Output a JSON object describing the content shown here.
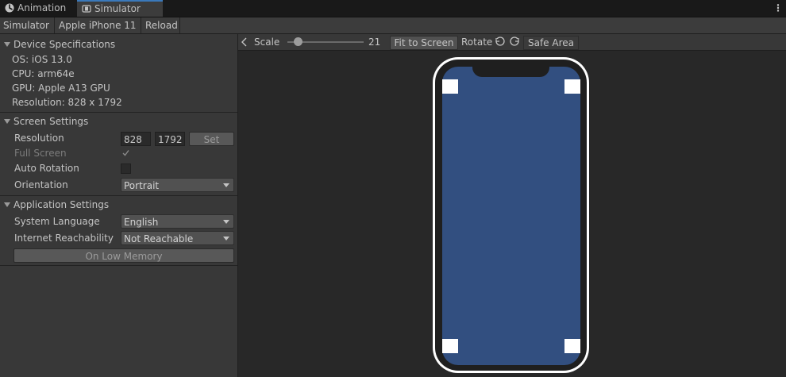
{
  "tabs": {
    "animation": "Animation",
    "simulator": "Simulator"
  },
  "toolbar": {
    "simulator": "Simulator",
    "device": "Apple iPhone 11",
    "reload": "Reload"
  },
  "device_specs": {
    "title": "Device Specifications",
    "os": "OS: iOS 13.0",
    "cpu": "CPU: arm64e",
    "gpu": "GPU: Apple A13 GPU",
    "resolution": "Resolution: 828 x 1792"
  },
  "screen_settings": {
    "title": "Screen Settings",
    "resolution_label": "Resolution",
    "width": "828",
    "height": "1792",
    "set_label": "Set",
    "full_screen_label": "Full Screen",
    "full_screen_checked": true,
    "auto_rotation_label": "Auto Rotation",
    "auto_rotation_checked": false,
    "orientation_label": "Orientation",
    "orientation_value": "Portrait"
  },
  "app_settings": {
    "title": "Application Settings",
    "language_label": "System Language",
    "language_value": "English",
    "reachability_label": "Internet Reachability",
    "reachability_value": "Not Reachable",
    "low_memory_label": "On Low Memory"
  },
  "viewport": {
    "scale_label": "Scale",
    "scale_value": "21",
    "fit_label": "Fit to Screen",
    "rotate_label": "Rotate",
    "safe_area_label": "Safe Area"
  },
  "colors": {
    "screen": "#324f80",
    "accent": "#3a79bb"
  },
  "icons": [
    "unity-icon",
    "simulator-icon",
    "kebab-menu-icon",
    "chevron-left-icon",
    "rotate-left-icon",
    "rotate-right-icon"
  ]
}
